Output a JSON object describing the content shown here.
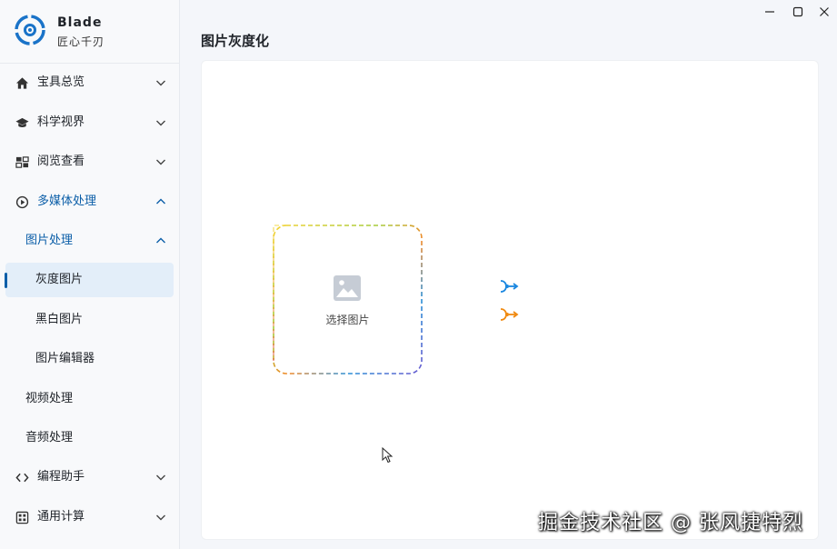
{
  "brand": {
    "name": "Blade",
    "subtitle": "匠心千刃",
    "accent": "#1a73c8"
  },
  "window": {
    "minimize": "—",
    "maximize": "☐",
    "close": "✕"
  },
  "sidebar": {
    "items": [
      {
        "label": "宝具总览",
        "icon": "home-icon"
      },
      {
        "label": "科学视界",
        "icon": "graduation-cap-icon"
      },
      {
        "label": "阅览查看",
        "icon": "grid-view-icon"
      },
      {
        "label": "多媒体处理",
        "icon": "media-play-icon"
      },
      {
        "label": "图片处理"
      },
      {
        "label": "灰度图片"
      },
      {
        "label": "黑白图片"
      },
      {
        "label": "图片编辑器"
      },
      {
        "label": "视频处理"
      },
      {
        "label": "音频处理"
      },
      {
        "label": "编程助手",
        "icon": "code-icon"
      },
      {
        "label": "通用计算",
        "icon": "calculator-icon"
      }
    ]
  },
  "page": {
    "title": "图片灰度化"
  },
  "picker": {
    "label": "选择图片",
    "icon": "image-icon"
  },
  "actions": [
    {
      "icon": "split-arrow-icon",
      "color": "#1a87e0"
    },
    {
      "icon": "split-arrow-icon",
      "color": "#f08a12"
    }
  ],
  "watermark": "掘金技术社区 @ 张风捷特烈"
}
